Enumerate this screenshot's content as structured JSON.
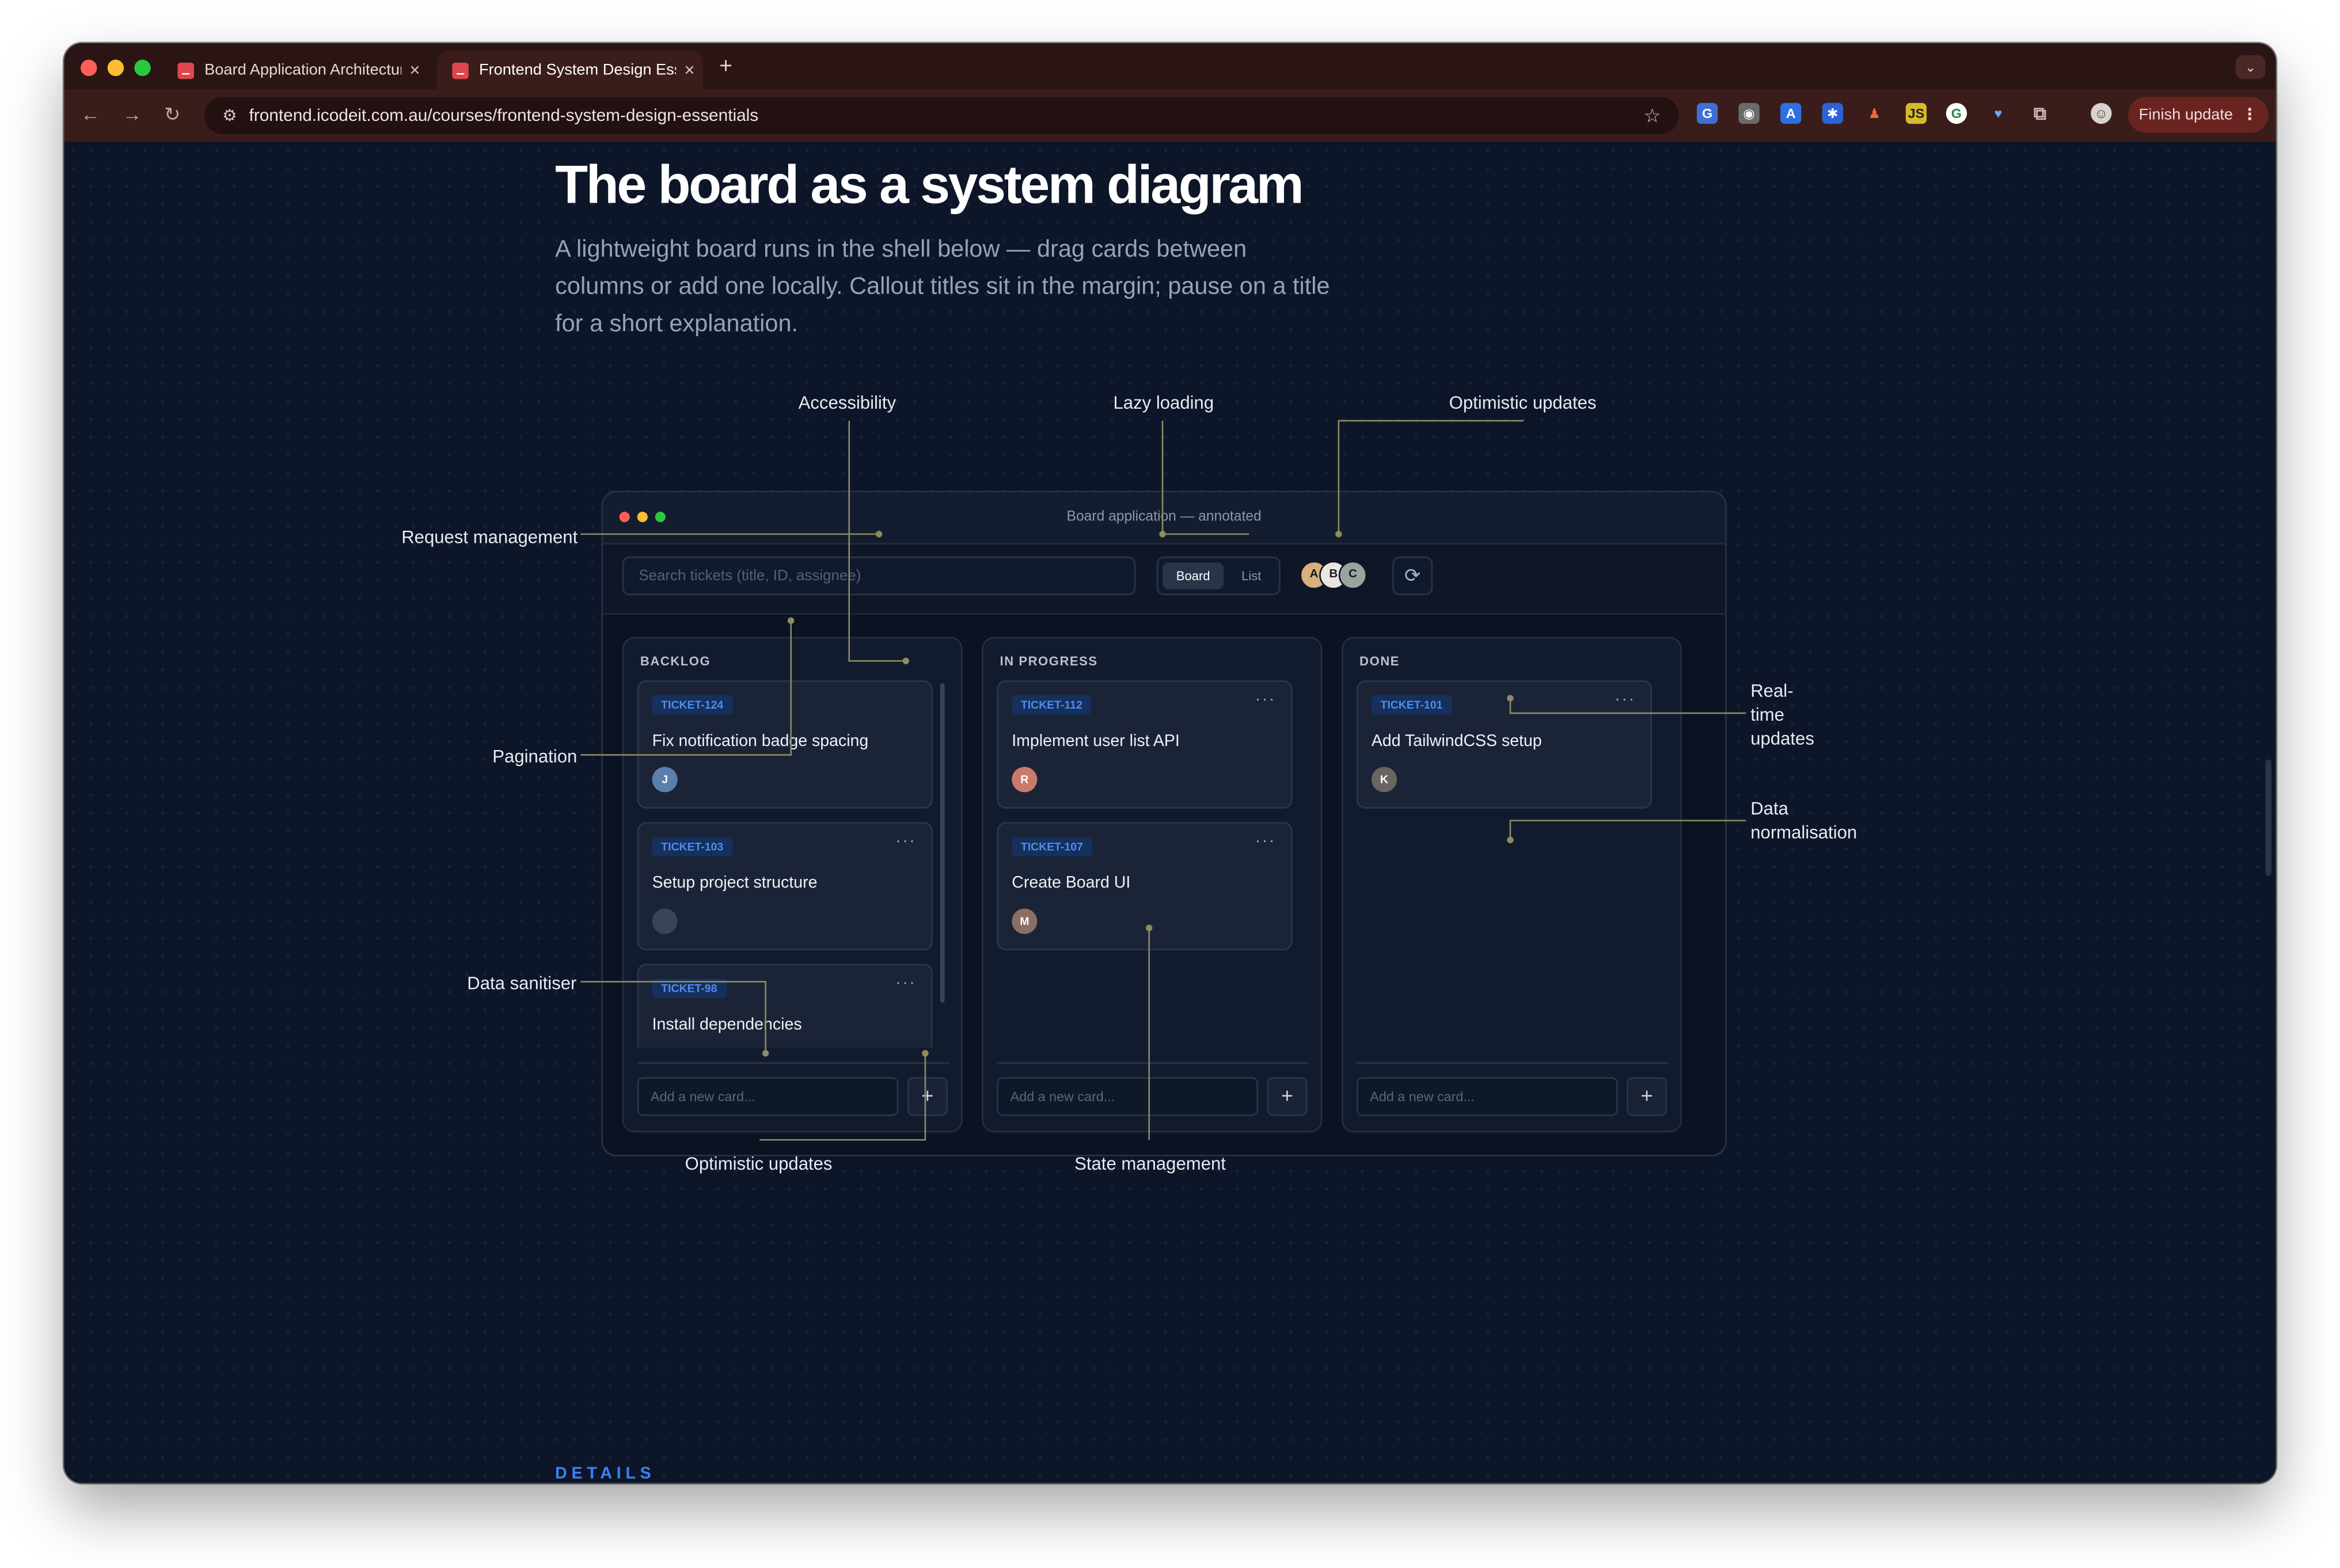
{
  "browser": {
    "tabs": [
      {
        "title": "Board Application Architectur",
        "active": false
      },
      {
        "title": "Frontend System Design Esse",
        "active": true
      }
    ],
    "url": "frontend.icodeit.com.au/courses/frontend-system-design-essentials",
    "finish_update_label": "Finish update",
    "new_tab_symbol": "+",
    "close_symbol": "×",
    "icons": [
      "back-arrow-icon",
      "forward-arrow-icon",
      "reload-icon",
      "site-settings-icon",
      "bookmark-star-icon",
      "extensions-puzzle-icon",
      "profile-avatar-icon",
      "kebab-menu-icon"
    ]
  },
  "page": {
    "headline": "The board as a system diagram",
    "lede": "A lightweight board runs in the shell below — drag cards between columns or add one locally. Callout titles sit in the margin; pause on a title for a short explanation.",
    "details_label": "DETAILS"
  },
  "board": {
    "window_title": "Board application — annotated",
    "search_placeholder": "Search tickets (title, ID, assignee)",
    "view_toggle": {
      "board": "Board",
      "list": "List",
      "selected": "Board"
    },
    "avatars": [
      "A",
      "B",
      "C"
    ],
    "refresh_icon": "refresh-icon",
    "columns": [
      {
        "title": "BACKLOG",
        "cards": [
          {
            "id": "TICKET-124",
            "title": "Fix notification badge spacing",
            "avatar": "J",
            "avatar_color": "#5a7fae"
          },
          {
            "id": "TICKET-103",
            "title": "Setup project structure",
            "avatar": "",
            "avatar_color": "#3a4456"
          },
          {
            "id": "TICKET-98",
            "title": "Install dependencies",
            "avatar": "",
            "avatar_color": "#3a4456"
          }
        ],
        "add_placeholder": "Add a new card..."
      },
      {
        "title": "IN PROGRESS",
        "cards": [
          {
            "id": "TICKET-112",
            "title": "Implement user list API",
            "avatar": "R",
            "avatar_color": "#c97b6b"
          },
          {
            "id": "TICKET-107",
            "title": "Create Board UI",
            "avatar": "M",
            "avatar_color": "#8a6f63"
          }
        ],
        "add_placeholder": "Add a new card..."
      },
      {
        "title": "DONE",
        "cards": [
          {
            "id": "TICKET-101",
            "title": "Add TailwindCSS setup",
            "avatar": "K",
            "avatar_color": "#6b6461"
          }
        ],
        "add_placeholder": "Add a new card..."
      }
    ],
    "more_symbol": "···",
    "add_symbol": "+"
  },
  "callouts": {
    "accessibility": "Accessibility",
    "lazy_loading": "Lazy loading",
    "optimistic_top": "Optimistic updates",
    "request_management": "Request management",
    "pagination": "Pagination",
    "data_sanitiser": "Data sanitiser",
    "realtime": "Real-time updates",
    "data_normalisation": "Data normalisation",
    "optimistic_bottom": "Optimistic updates",
    "state_management": "State management"
  },
  "colors": {
    "page_bg": "#0d1628",
    "accent": "#3b82f6",
    "callout_line": "#8f8a62",
    "badge_text": "#4d8df0"
  }
}
